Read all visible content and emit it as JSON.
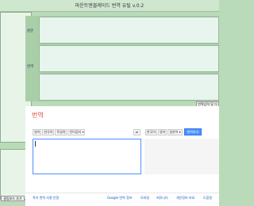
{
  "window": {
    "title": "마운트앤블레이드 번역 유틸 v.0.2"
  },
  "left": {
    "button_label": "클립보드 추가"
  },
  "editor": {
    "source_label": "원문",
    "translation_label": "번역",
    "bottom_button": "번역입력 및 다"
  },
  "google": {
    "title": "번역",
    "source_langs": [
      "영어",
      "한국어",
      "독일어",
      "언어감지"
    ],
    "swap_icon": "swap-icon",
    "target_langs": [
      "한국어",
      "영어",
      "일본어"
    ],
    "translate_button": "번역하기",
    "footer_left": "즉석 번역 사용 안함",
    "footer_links": [
      "Google 번역 정보",
      "모바일",
      "커뮤니티",
      "개인정보 보호",
      "도움말"
    ]
  },
  "colors": {
    "accent": "#dd4b39",
    "button": "#4d90fe",
    "background": "#b9dbb9"
  }
}
